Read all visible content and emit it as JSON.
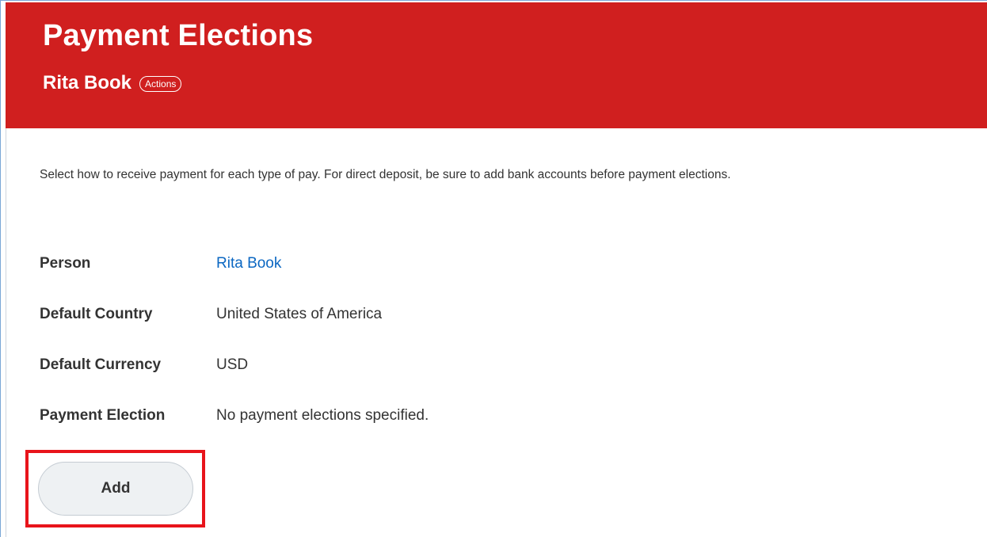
{
  "header": {
    "title": "Payment Elections",
    "subtitle": "Rita Book",
    "actions_label": "Actions",
    "background_color": "#d01f1f"
  },
  "instructions": "Select how to receive payment for each type of pay. For direct deposit, be sure to add bank accounts before payment elections.",
  "fields": [
    {
      "label": "Person",
      "value": "Rita Book",
      "is_link": true
    },
    {
      "label": "Default Country",
      "value": "United States of America",
      "is_link": false
    },
    {
      "label": "Default Currency",
      "value": "USD",
      "is_link": false
    },
    {
      "label": "Payment Election",
      "value": "No payment elections specified.",
      "is_link": false
    }
  ],
  "add_button": {
    "label": "Add",
    "highlighted": true,
    "highlight_color": "#e8141b"
  },
  "colors": {
    "link": "#0b67c2",
    "text": "#333333"
  }
}
